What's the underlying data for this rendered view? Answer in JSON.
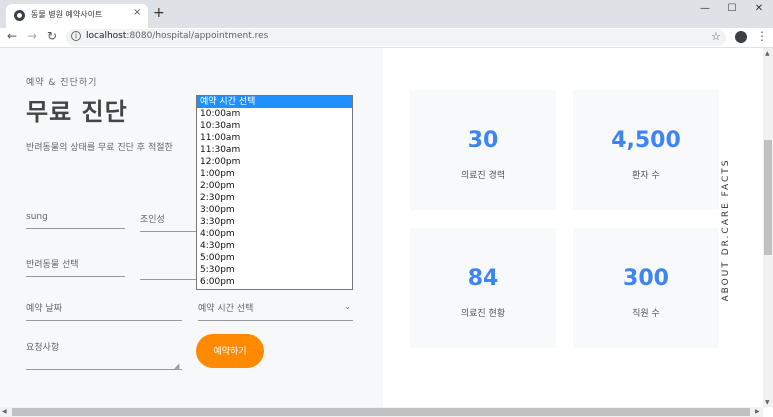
{
  "browser": {
    "tab_title": "동물 병원 예약사이트",
    "tab_close": "×",
    "new_tab": "+",
    "url_host": "localhost",
    "url_path": ":8080/hospital/appointment.res",
    "back": "←",
    "forward": "→",
    "reload": "↻",
    "star": "☆",
    "menu": "⋮",
    "minimize": "—",
    "maximize": "☐",
    "close": "✕"
  },
  "form": {
    "subtitle": "예약 & 진단하기",
    "title": "무료 진단",
    "description": "반려동물의 상태를 무료 진단 후 적절한",
    "name_value": "sung",
    "owner_value": "조인성",
    "pet_select": "반려동물 선택",
    "date_placeholder": "예약 날짜",
    "time_select": "예약 시간 선택",
    "request_placeholder": "요청사항",
    "submit_label": "예약하기"
  },
  "dropdown": {
    "options": [
      "예약 시간 선택",
      "10:00am",
      "10:30am",
      "11:00am",
      "11:30am",
      "12:00pm",
      "1:00pm",
      "2:00pm",
      "2:30pm",
      "3:00pm",
      "3:30pm",
      "4:00pm",
      "4:30pm",
      "5:00pm",
      "5:30pm",
      "6:00pm"
    ],
    "selected_index": 0
  },
  "stats": {
    "vertical_label": "ABOUT DR.CARE FACTS",
    "cards": [
      {
        "number": "30",
        "label": "의료진 경력"
      },
      {
        "number": "4,500",
        "label": "환자 수"
      },
      {
        "number": "84",
        "label": "의료진 현황"
      },
      {
        "number": "300",
        "label": "직원 수"
      }
    ]
  },
  "colors": {
    "accent": "#ff8a00",
    "stat_number": "#3d85f5",
    "selected_option": "#1e90ff"
  }
}
